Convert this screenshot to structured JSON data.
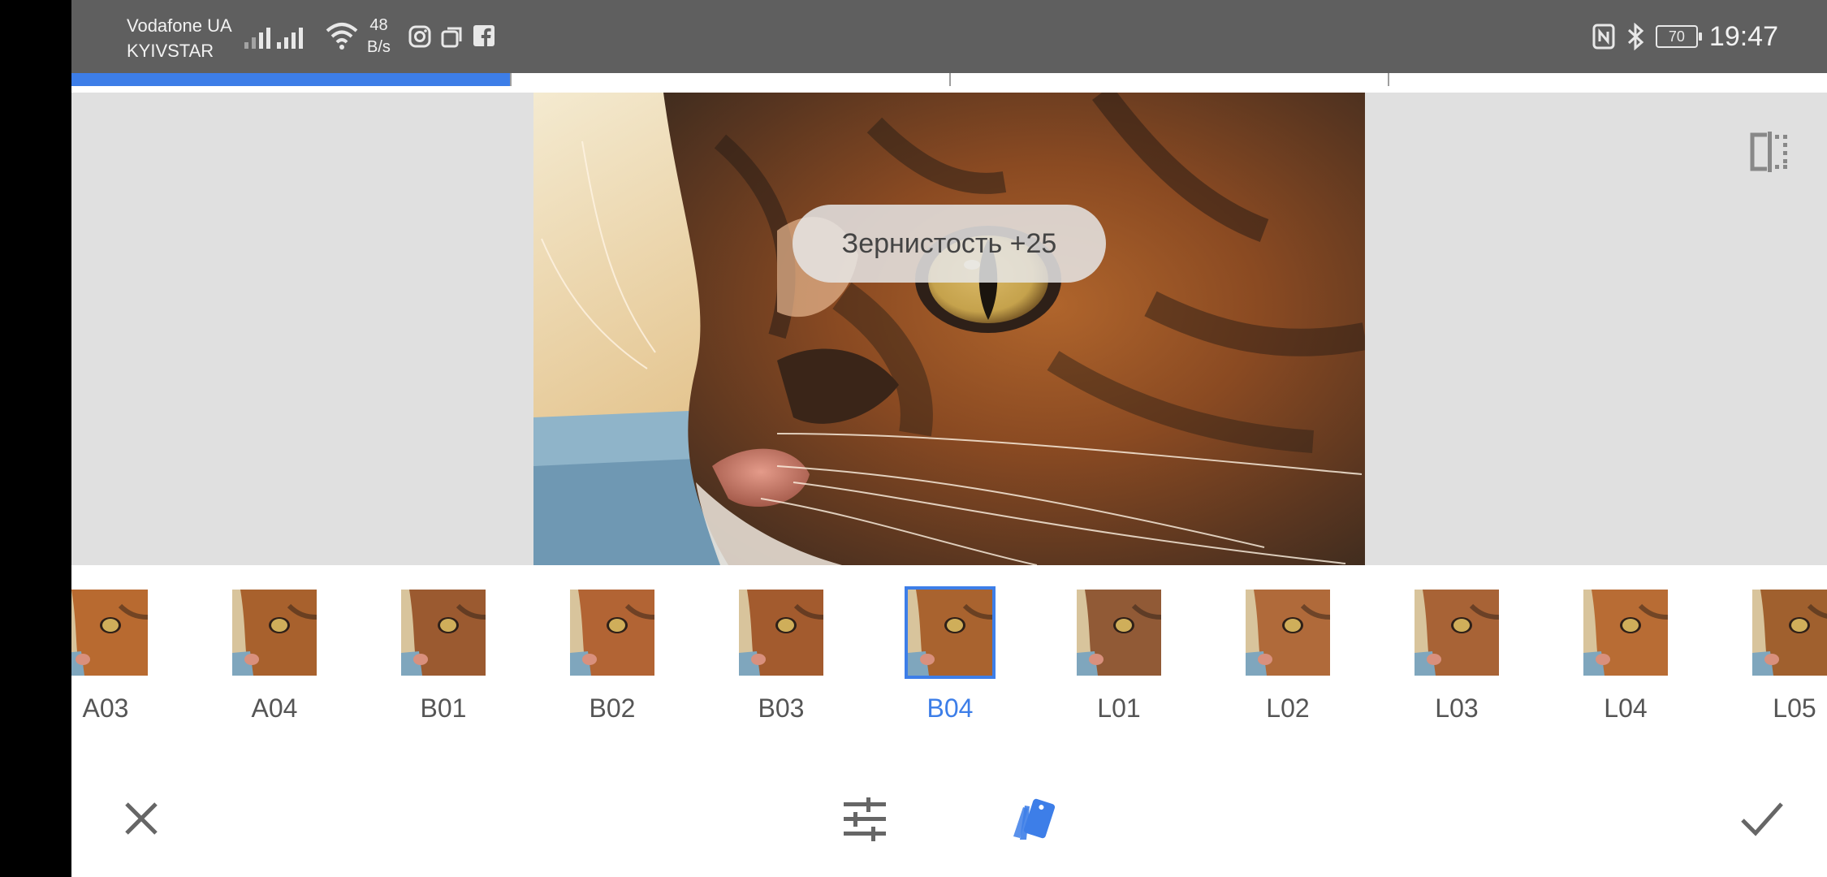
{
  "status_bar": {
    "carrier1": "Vodafone UA",
    "carrier2": "KYIVSTAR",
    "speed_value": "48",
    "speed_unit": "B/s",
    "battery": "70",
    "time": "19:47",
    "icons": [
      "signal-icon",
      "wifi-icon",
      "instagram-icon",
      "recent-apps-icon",
      "facebook-icon",
      "nfc-icon",
      "bluetooth-icon",
      "battery-icon"
    ]
  },
  "editor": {
    "toast": "Зернистость +25",
    "progress": {
      "segments": 4,
      "active_segment": 1
    }
  },
  "filters": {
    "items": [
      "A03",
      "A04",
      "B01",
      "B02",
      "B03",
      "B04",
      "L01",
      "L02",
      "L03",
      "L04",
      "L05"
    ],
    "selected": "B04"
  },
  "colors": {
    "accent": "#3d7ee8",
    "status_bar": "#5f5f5f",
    "canvas_bg": "#e0e0e0"
  },
  "bottom_bar": {
    "icons": [
      "close-icon",
      "tune-icon",
      "styles-icon",
      "check-icon"
    ]
  }
}
